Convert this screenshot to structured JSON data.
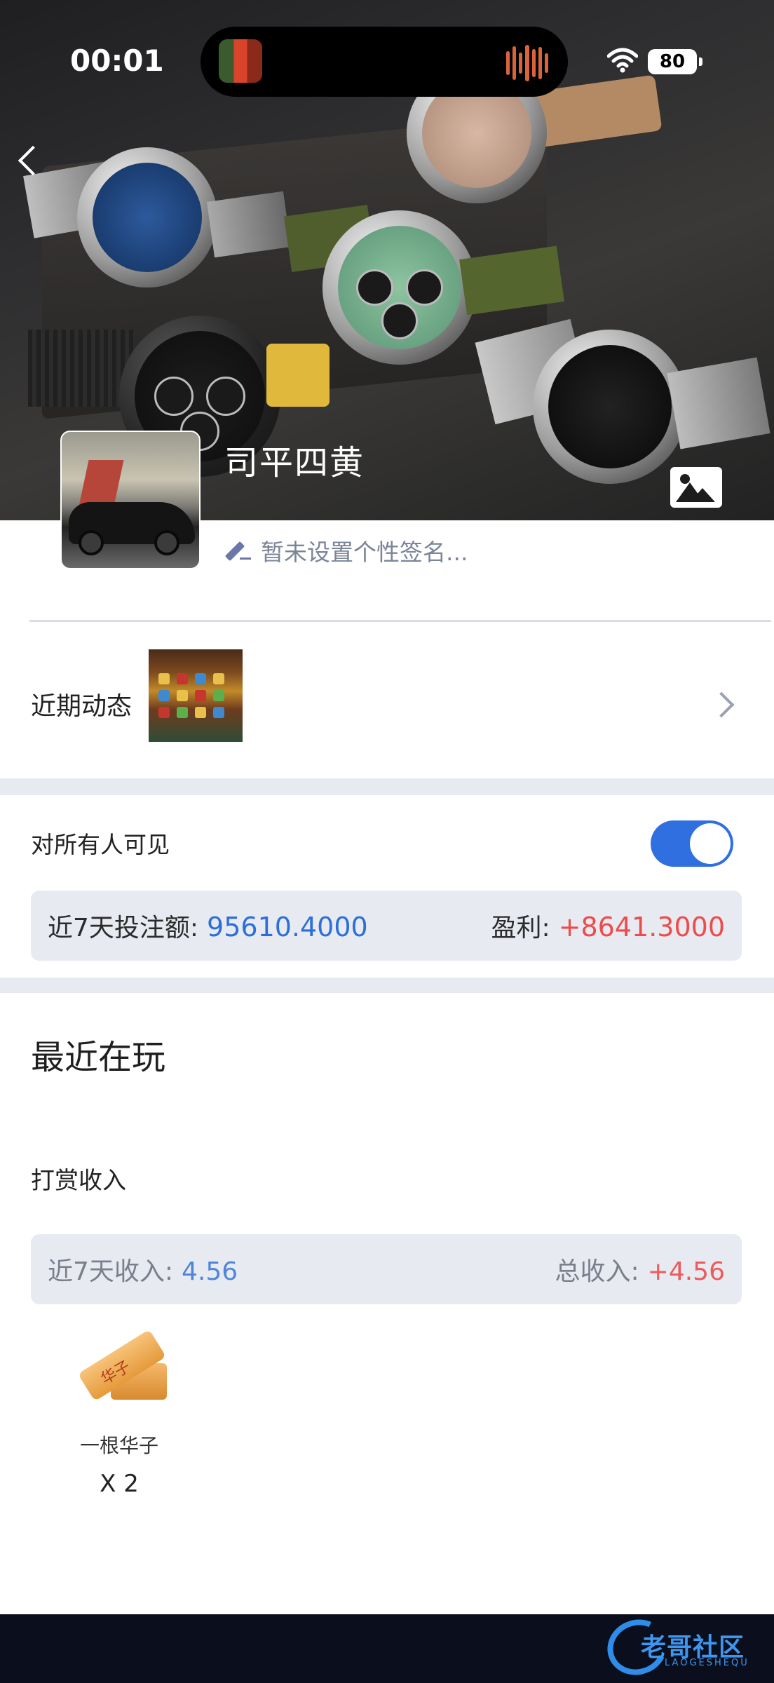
{
  "status_bar": {
    "time": "00:01",
    "battery": "80"
  },
  "profile": {
    "username": "司平四黄",
    "signature_placeholder": "暂未设置个性签名..."
  },
  "recent": {
    "label": "近期动态"
  },
  "visibility": {
    "label": "对所有人可见",
    "enabled": true
  },
  "bet_stats": {
    "bet_label": "近7天投注额:",
    "bet_value": "95610.4000",
    "profit_label": "盈利:",
    "profit_value": "+8641.3000"
  },
  "playing": {
    "title": "最近在玩"
  },
  "tips": {
    "title": "打赏收入",
    "income_label": "近7天收入:",
    "income_value": "4.56",
    "total_label": "总收入:",
    "total_value": "+4.56",
    "gifts": [
      {
        "name": "一根华子",
        "count": "X 2",
        "image_text": "华子"
      }
    ]
  },
  "footer": {
    "logo_text": "老哥社区",
    "logo_sub": "LAOGESHEQU"
  },
  "colors": {
    "accent_blue": "#2f6fe0",
    "bet_blue": "#2d6fd8",
    "profit_red": "#ee4b4b",
    "band_gray": "#e8eaf1",
    "footer_bg": "#0b0e1c"
  }
}
